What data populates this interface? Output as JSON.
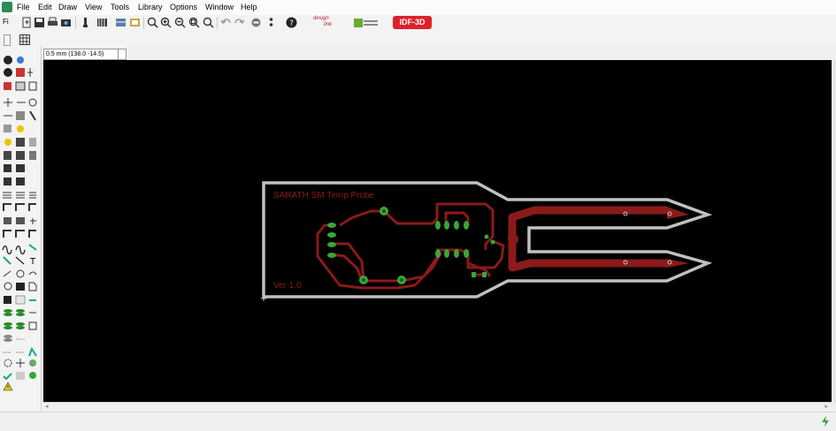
{
  "menu": {
    "fi_label": "Fi",
    "items": [
      "File",
      "Edit",
      "Draw",
      "View",
      "Tools",
      "Library",
      "Options",
      "Window",
      "Help"
    ]
  },
  "toolbar": {
    "brand_design": "design",
    "brand_link": "link",
    "idf_button": "IDF-3D"
  },
  "coordinate_display": "0.5 mm (138.0 -14.5)",
  "board": {
    "title_text": "SARATH SM Temp Probe",
    "version_text": "Ver 1.0"
  },
  "colors": {
    "canvas": "#000000",
    "outline": "#c0c0c0",
    "copper": "#8b1a1a",
    "pad": "#3aa53a",
    "idf": "#e0202b"
  }
}
